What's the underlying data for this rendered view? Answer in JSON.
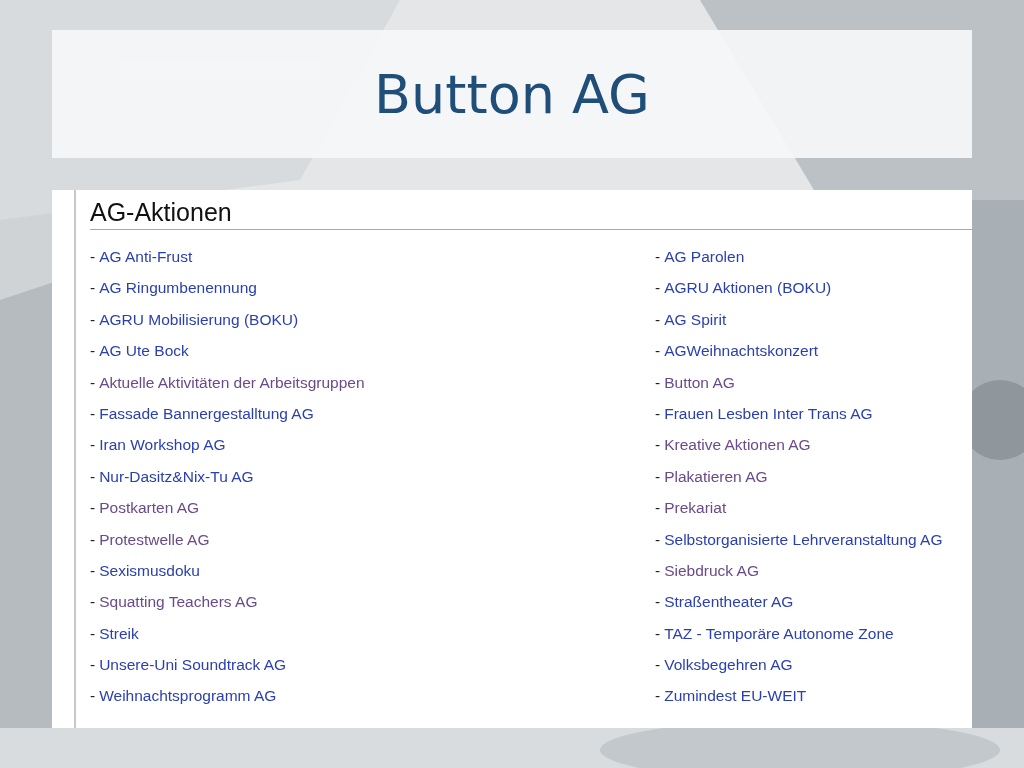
{
  "slide": {
    "title": "Button AG"
  },
  "page": {
    "heading": "AG-Aktionen",
    "columns": [
      [
        {
          "marker": "-",
          "label": "AG Anti-Frust",
          "visited": false
        },
        {
          "marker": "-",
          "label": "AG Ringumbenennung",
          "visited": false
        },
        {
          "marker": "-",
          "label": "AGRU Mobilisierung (BOKU)",
          "visited": false
        },
        {
          "marker": "-",
          "label": "AG Ute Bock",
          "visited": false
        },
        {
          "marker": "-",
          "label": "Aktuelle Aktivitäten der Arbeitsgruppen",
          "visited": true
        },
        {
          "marker": "-",
          "label": "Fassade Bannergestalltung AG",
          "visited": false
        },
        {
          "marker": "-",
          "label": "Iran Workshop AG",
          "visited": false
        },
        {
          "marker": "-",
          "label": "Nur-Dasitz&Nix-Tu AG",
          "visited": false
        },
        {
          "marker": "-",
          "label": "Postkarten AG",
          "visited": true
        },
        {
          "marker": "-",
          "label": "Protestwelle AG",
          "visited": true
        },
        {
          "marker": "-",
          "label": "Sexismusdoku",
          "visited": false
        },
        {
          "marker": "-",
          "label": "Squatting Teachers AG",
          "visited": true
        },
        {
          "marker": "-",
          "label": "Streik",
          "visited": false
        },
        {
          "marker": "-",
          "label": "Unsere-Uni Soundtrack AG",
          "visited": false
        },
        {
          "marker": "-",
          "label": "Weihnachtsprogramm AG",
          "visited": false
        }
      ],
      [
        {
          "marker": "-",
          "label": "AG Parolen",
          "visited": false
        },
        {
          "marker": "-",
          "label": "AGRU Aktionen (BOKU)",
          "visited": false
        },
        {
          "marker": "-",
          "label": "AG Spirit",
          "visited": false
        },
        {
          "marker": "-",
          "label": "AGWeihnachtskonzert",
          "visited": false
        },
        {
          "marker": "-",
          "label": "Button AG",
          "visited": true
        },
        {
          "marker": "-",
          "label": "Frauen Lesben Inter Trans AG",
          "visited": false
        },
        {
          "marker": "-",
          "label": "Kreative Aktionen AG",
          "visited": true
        },
        {
          "marker": "-",
          "label": "Plakatieren AG",
          "visited": true
        },
        {
          "marker": "-",
          "label": "Prekariat",
          "visited": true
        },
        {
          "marker": "-",
          "label": "Selbstorganisierte Lehrveranstaltung AG",
          "visited": false
        },
        {
          "marker": "-",
          "label": "Siebdruck AG",
          "visited": true
        },
        {
          "marker": "-",
          "label": "Straßentheater AG",
          "visited": false
        },
        {
          "marker": "-",
          "label": "TAZ - Temporäre Autonome Zone",
          "visited": false
        },
        {
          "marker": "-",
          "label": "Volksbegehren AG",
          "visited": false
        },
        {
          "marker": "-",
          "label": "Zumindest EU-WEIT",
          "visited": false
        }
      ]
    ]
  }
}
